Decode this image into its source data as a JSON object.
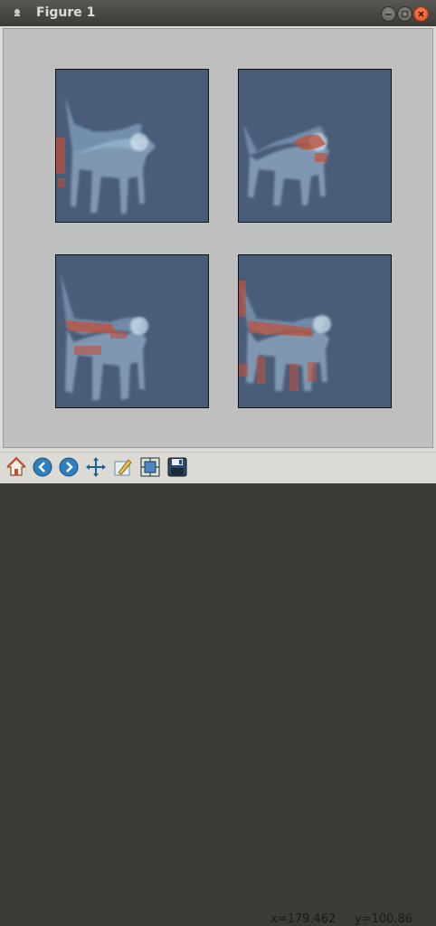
{
  "window": {
    "title": "Figure 1"
  },
  "toolbar": {
    "buttons": [
      {
        "name": "home-icon"
      },
      {
        "name": "back-arrow-icon"
      },
      {
        "name": "forward-arrow-icon"
      },
      {
        "name": "pan-icon"
      },
      {
        "name": "configure-subplots-icon"
      },
      {
        "name": "zoom-to-rect-icon"
      },
      {
        "name": "save-icon"
      }
    ],
    "x_readout": "x=179.462",
    "y_readout": "y=100.86"
  },
  "figure": {
    "subplot_count": 4,
    "background": "#4a5d78",
    "highlight_color": "#c0503a",
    "figure_bg": "#bfbfbf"
  }
}
